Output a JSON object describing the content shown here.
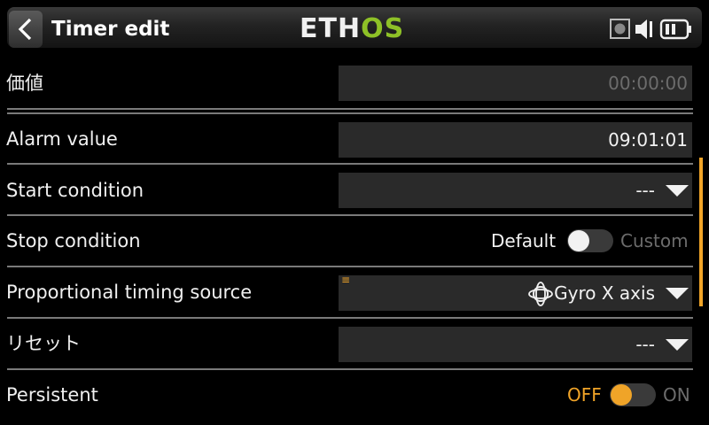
{
  "header": {
    "title": "Timer edit",
    "logo_left": "ETH",
    "logo_right": "OS",
    "brand_green": "#8ec127",
    "icons": [
      "back-arrow-icon",
      "record-icon",
      "speaker-icon",
      "battery-icon"
    ]
  },
  "rows": {
    "value": {
      "label": "価値",
      "value": "00:00:00"
    },
    "alarm": {
      "label": "Alarm value",
      "value": "09:01:01"
    },
    "start": {
      "label": "Start condition",
      "value": "---"
    },
    "stop": {
      "label": "Stop condition",
      "left": "Default",
      "right": "Custom",
      "state": "Default"
    },
    "prop": {
      "label": "Proportional timing source",
      "value": "Gyro X axis",
      "source_icon": "gyro-icon",
      "marker": "≡"
    },
    "reset": {
      "label": "リセット",
      "value": "---"
    },
    "persistent": {
      "label": "Persistent",
      "off": "OFF",
      "on": "ON",
      "state": "OFF"
    }
  },
  "colors": {
    "accent": "#f0a428",
    "field_bg": "#2a2a2a",
    "separator": "#7a7a7a"
  }
}
